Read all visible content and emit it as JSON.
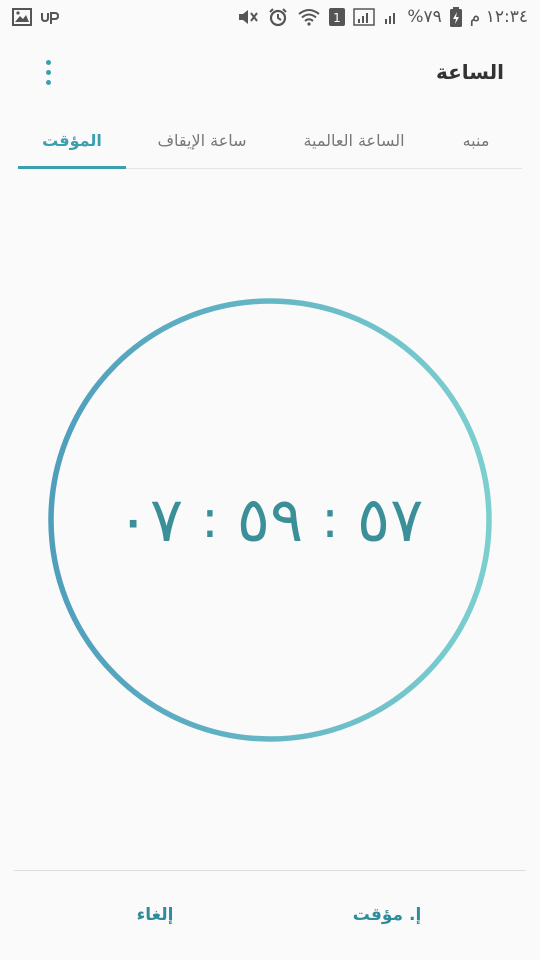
{
  "status_bar": {
    "time": "١٢:٣٤ م",
    "battery": "%٧٩",
    "sim_badge": "1",
    "carrier_icon": "up-icon",
    "icons": [
      "image-icon",
      "mute-icon",
      "alarm-icon",
      "wifi-icon",
      "sim-icon",
      "signal-icon",
      "battery-icon"
    ]
  },
  "header": {
    "title": "الساعة"
  },
  "tabs": [
    {
      "label": "منبه",
      "active": false
    },
    {
      "label": "الساعة العالمية",
      "active": false
    },
    {
      "label": "ساعة الإيقاف",
      "active": false
    },
    {
      "label": "المؤقت",
      "active": true
    }
  ],
  "timer": {
    "hours": "٠٧",
    "minutes": "٥٩",
    "seconds": "٥٧",
    "separator": ":",
    "progress_remaining": 1.0
  },
  "actions": {
    "pause_label": "إ. مؤقت",
    "cancel_label": "إلغاء"
  },
  "colors": {
    "accent": "#3aa0b0",
    "ring_start": "#5aa7c0",
    "ring_end": "#79cccc",
    "digits": "#3a8f98"
  }
}
